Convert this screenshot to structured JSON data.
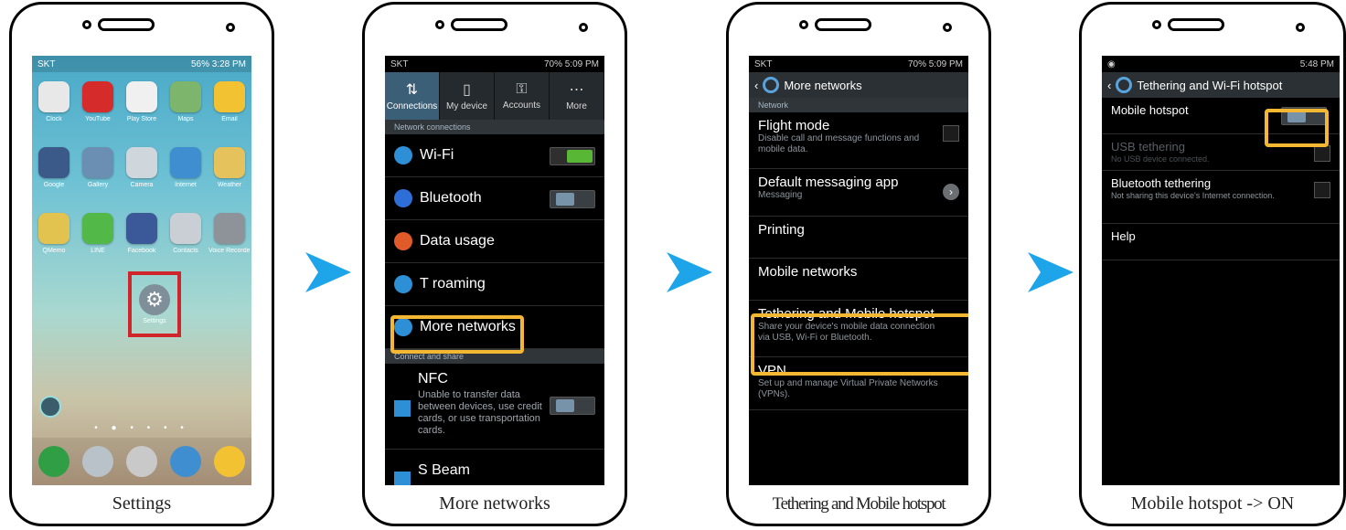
{
  "colors": {
    "arrow": "#1ea5e9",
    "highlight_red": "#d0262b",
    "highlight_yellow": "#f3b732",
    "toggle_on": "#58b835"
  },
  "step1": {
    "caption": "Settings",
    "status": {
      "left": "SKT",
      "right": "56% 3:28 PM"
    },
    "apps": [
      {
        "label": "Clock",
        "icon": "clock-icon",
        "color": "#e8e8e8"
      },
      {
        "label": "YouTube",
        "icon": "youtube-icon",
        "color": "#d62b2b"
      },
      {
        "label": "Play Store",
        "icon": "play-store-icon",
        "color": "#f0f0f0"
      },
      {
        "label": "Maps",
        "icon": "maps-icon",
        "color": "#7cb56b"
      },
      {
        "label": "Email",
        "icon": "email-icon",
        "color": "#f2c233"
      },
      {
        "label": "Google",
        "icon": "google-icon",
        "color": "#3b5a8a"
      },
      {
        "label": "Gallery",
        "icon": "gallery-icon",
        "color": "#6b8fb3"
      },
      {
        "label": "Camera",
        "icon": "camera-icon",
        "color": "#cfd6dc"
      },
      {
        "label": "Internet",
        "icon": "internet-icon",
        "color": "#3f8fd0"
      },
      {
        "label": "Weather",
        "icon": "weather-icon",
        "color": "#e5c25b"
      },
      {
        "label": "QMemo",
        "icon": "memo-icon",
        "color": "#e3c34f"
      },
      {
        "label": "LINE",
        "icon": "line-icon",
        "color": "#52b848"
      },
      {
        "label": "Facebook",
        "icon": "facebook-icon",
        "color": "#3b5998"
      },
      {
        "label": "Contacts",
        "icon": "contacts-icon",
        "color": "#c9cfd4"
      },
      {
        "label": "Voice Recorder",
        "icon": "recorder-icon",
        "color": "#8d9399"
      }
    ],
    "settings_app_label": "Settings",
    "dock": [
      {
        "icon": "phone-icon",
        "color": "#2f9e45"
      },
      {
        "icon": "contacts-icon",
        "color": "#b9c2c9"
      },
      {
        "icon": "apps-icon",
        "color": "#c9c9c9"
      },
      {
        "icon": "internet-icon",
        "color": "#3f8fd0"
      },
      {
        "icon": "messaging-icon",
        "color": "#f2c233"
      }
    ]
  },
  "step2": {
    "caption": "More networks",
    "status": {
      "left": "SKT",
      "right": "70% 5:09 PM"
    },
    "tabs": [
      "Connections",
      "My device",
      "Accounts",
      "More"
    ],
    "section1": "Network connections",
    "rows": [
      {
        "label": "Wi-Fi",
        "icon": "wifi-icon",
        "color": "#2d8fd6",
        "toggle": "on"
      },
      {
        "label": "Bluetooth",
        "icon": "bluetooth-icon",
        "color": "#2d6fd6",
        "toggle": "off"
      },
      {
        "label": "Data usage",
        "icon": "data-usage-icon",
        "color": "#e05a2a",
        "toggle": ""
      },
      {
        "label": "T roaming",
        "icon": "globe-icon",
        "color": "#2d8fd6",
        "toggle": ""
      },
      {
        "label": "More networks",
        "icon": "more-networks-icon",
        "color": "#2d8fd6",
        "toggle": ""
      }
    ],
    "section2": "Connect and share",
    "nfc": {
      "label": "NFC",
      "desc": "Unable to transfer data between devices, use credit cards, or use transportation cards."
    },
    "sbeam": "S Beam"
  },
  "step3": {
    "caption": "Tethering and Mobile hotspot",
    "status": {
      "left": "SKT",
      "right": "70% 5:09 PM"
    },
    "title": "More networks",
    "section": "Network",
    "rows": [
      {
        "title": "Flight mode",
        "sub": "Disable call and message functions and mobile data.",
        "control": "checkbox"
      },
      {
        "title": "Default messaging app",
        "sub": "Messaging",
        "control": "chevron"
      },
      {
        "title": "Printing",
        "sub": "",
        "control": ""
      },
      {
        "title": "Mobile networks",
        "sub": "",
        "control": ""
      },
      {
        "title": "Tethering and Mobile hotspot",
        "sub": "Share your device's mobile data connection via USB, Wi-Fi or Bluetooth.",
        "control": ""
      },
      {
        "title": "VPN",
        "sub": "Set up and manage Virtual Private Networks (VPNs).",
        "control": ""
      }
    ]
  },
  "step4": {
    "caption": "Mobile hotspot -> ON",
    "status": {
      "left": "",
      "right": "5:48 PM"
    },
    "title": "Tethering and Wi-Fi hotspot",
    "rows": [
      {
        "title": "Mobile hotspot",
        "sub": "",
        "control": "toggle",
        "dim": false
      },
      {
        "title": "USB tethering",
        "sub": "No USB device connected.",
        "control": "checkbox",
        "dim": true
      },
      {
        "title": "Bluetooth tethering",
        "sub": "Not sharing this device's Internet connection.",
        "control": "checkbox",
        "dim": false
      },
      {
        "title": "Help",
        "sub": "",
        "control": "",
        "dim": false
      }
    ]
  }
}
